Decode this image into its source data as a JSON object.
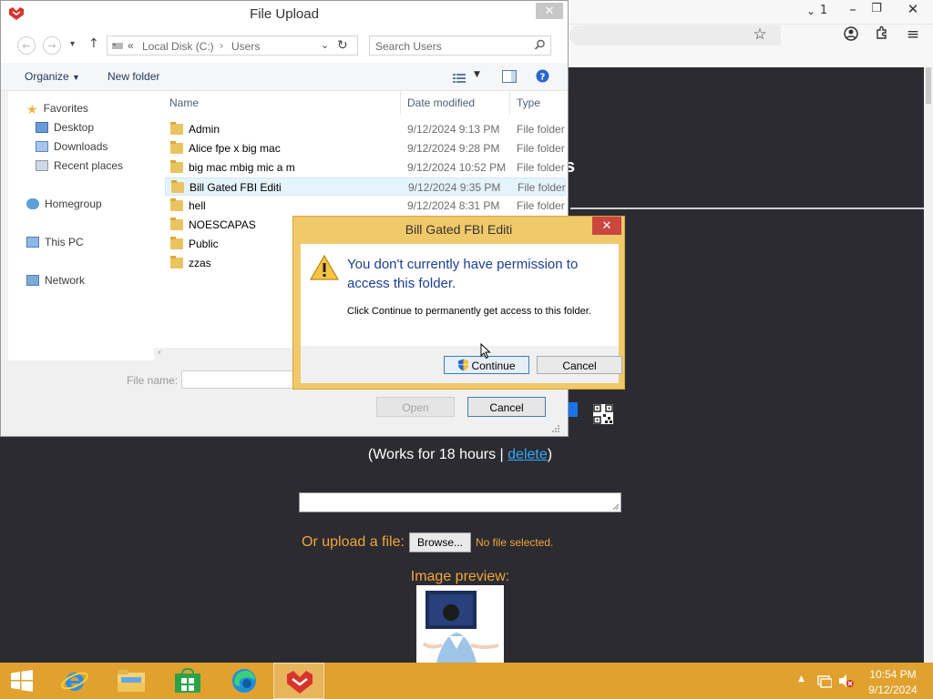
{
  "browser": {
    "tab_count": "1",
    "heading_tail": "s",
    "works_prefix": "(Works for 18 hours | ",
    "delete_link": "delete",
    "works_suffix": ")",
    "upload_label": "Or upload a file:",
    "browse_label": "Browse...",
    "no_file": "No file selected.",
    "preview_label": "Image preview:"
  },
  "file_dialog": {
    "title": "File Upload",
    "close_glyph": "✕",
    "address": [
      "Local Disk (C:)",
      "Users"
    ],
    "search_placeholder": "Search Users",
    "organize_label": "Organize",
    "new_folder_label": "New folder",
    "sidebar": {
      "favorites": "Favorites",
      "desktop": "Desktop",
      "downloads": "Downloads",
      "recent": "Recent places",
      "homegroup": "Homegroup",
      "this_pc": "This PC",
      "network": "Network"
    },
    "columns": {
      "name": "Name",
      "date": "Date modified",
      "type": "Type"
    },
    "files": [
      {
        "name": "Admin",
        "date": "9/12/2024 9:13 PM",
        "type": "File folder"
      },
      {
        "name": "Alice fpe x big mac",
        "date": "9/12/2024 9:28 PM",
        "type": "File folder"
      },
      {
        "name": "big mac mbig mic a m",
        "date": "9/12/2024 10:52 PM",
        "type": "File folder"
      },
      {
        "name": "Bill Gated FBI Editi",
        "date": "9/12/2024 9:35 PM",
        "type": "File folder"
      },
      {
        "name": "hell",
        "date": "9/12/2024 8:31 PM",
        "type": "File folder"
      },
      {
        "name": "NOESCAPAS",
        "date": "",
        "type": ""
      },
      {
        "name": "Public",
        "date": "",
        "type": ""
      },
      {
        "name": "zzas",
        "date": "",
        "type": ""
      }
    ],
    "selected_index": 3,
    "file_name_label": "File name:",
    "file_name_value": "",
    "open_label": "Open",
    "cancel_label": "Cancel"
  },
  "permission_dialog": {
    "title": "Bill Gated FBI Editi",
    "close_glyph": "✕",
    "main_message": "You don't currently have permission to access this folder.",
    "sub_message": "Click Continue to permanently get access to this folder.",
    "continue_label": "Continue",
    "cancel_label": "Cancel"
  },
  "taskbar": {
    "time": "10:54 PM",
    "date": "9/12/2024"
  },
  "colors": {
    "taskbar": "#e0a12e",
    "page_bg": "#2b2b31",
    "accent_orange": "#f3a63a",
    "link_blue": "#33a8ff",
    "perm_frame": "#f0c96a"
  }
}
